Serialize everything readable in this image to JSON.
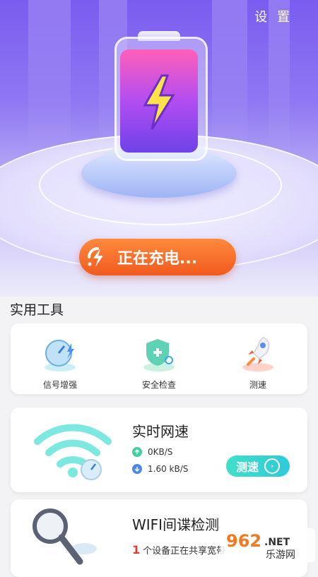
{
  "header": {
    "settings_label": "设 置"
  },
  "hero": {
    "charging_label": "正在充电...",
    "battery_icon": "battery-charging-icon"
  },
  "tools": {
    "title": "实用工具",
    "items": [
      {
        "label": "信号增强",
        "icon": "signal-boost-icon"
      },
      {
        "label": "安全检查",
        "icon": "security-check-icon"
      },
      {
        "label": "测速",
        "icon": "rocket-icon"
      }
    ]
  },
  "speed": {
    "title": "实时网速",
    "upload": "0KB/S",
    "download": "1.60 kB/S",
    "button_label": "测速",
    "icon": "wifi-speed-icon"
  },
  "wifi_check": {
    "title": "WIFI间谍检测",
    "device_count": "1",
    "sharing_text": "个设备正在共享宽带",
    "icon": "magnifier-icon"
  },
  "watermark": {
    "text_top": "962.NET",
    "text_bottom": "乐游网"
  },
  "colors": {
    "accent": "#f05a1e",
    "purple": "#7b5cf0",
    "teal": "#2fc9d9"
  }
}
